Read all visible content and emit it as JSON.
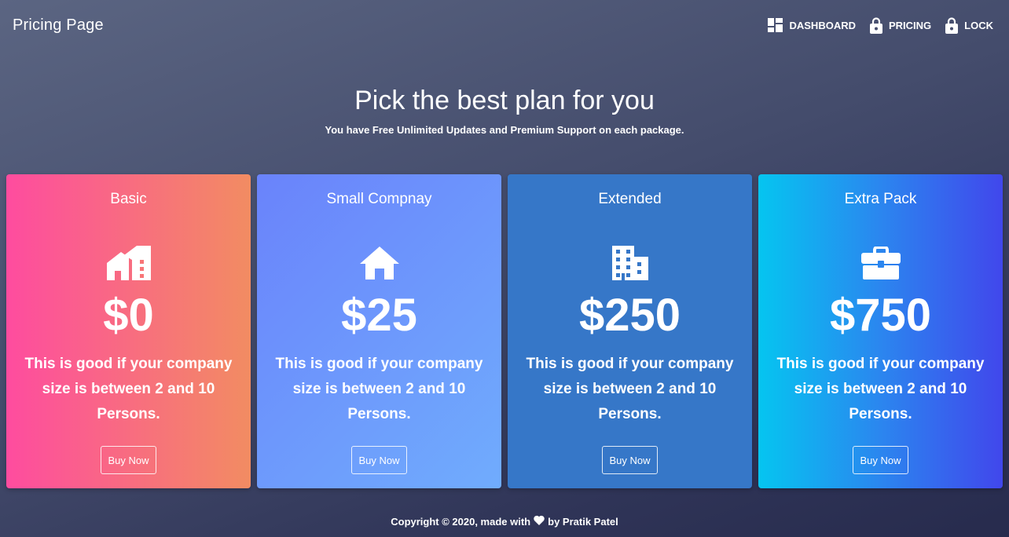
{
  "header": {
    "title": "Pricing Page",
    "nav": [
      {
        "label": "Dashboard",
        "icon": "dashboard-icon"
      },
      {
        "label": "Pricing",
        "icon": "lock-open-icon"
      },
      {
        "label": "Lock",
        "icon": "lock-icon"
      }
    ]
  },
  "hero": {
    "title": "Pick the best plan for you",
    "subtitle": "You have Free Unlimited Updates and Premium Support on each package."
  },
  "plans": [
    {
      "name": "Basic",
      "icon": "homes-icon",
      "price": "$0",
      "description": "This is good if your company size is between 2 and 10 Persons.",
      "button": "Buy Now",
      "colors": [
        "#fe4c9f",
        "#f28c62"
      ]
    },
    {
      "name": "Small Compnay",
      "icon": "home-icon",
      "price": "$25",
      "description": "This is good if your company size is between 2 and 10 Persons.",
      "button": "Buy Now",
      "colors": [
        "#6a83fb",
        "#70acfd"
      ]
    },
    {
      "name": "Extended",
      "icon": "business-icon",
      "price": "$250",
      "description": "This is good if your company size is between 2 and 10 Persons.",
      "button": "Buy Now",
      "colors": [
        "#3677c8",
        "#3677c8"
      ]
    },
    {
      "name": "Extra Pack",
      "icon": "briefcase-icon",
      "price": "$750",
      "description": "This is good if your company size is between 2 and 10 Persons.",
      "button": "Buy Now",
      "colors": [
        "#05c5f0",
        "#4147ec"
      ]
    }
  ],
  "footer": {
    "prefix": "Copyright © 2020, made with",
    "icon": "heart-icon",
    "suffix": "by Pratik Patel"
  }
}
